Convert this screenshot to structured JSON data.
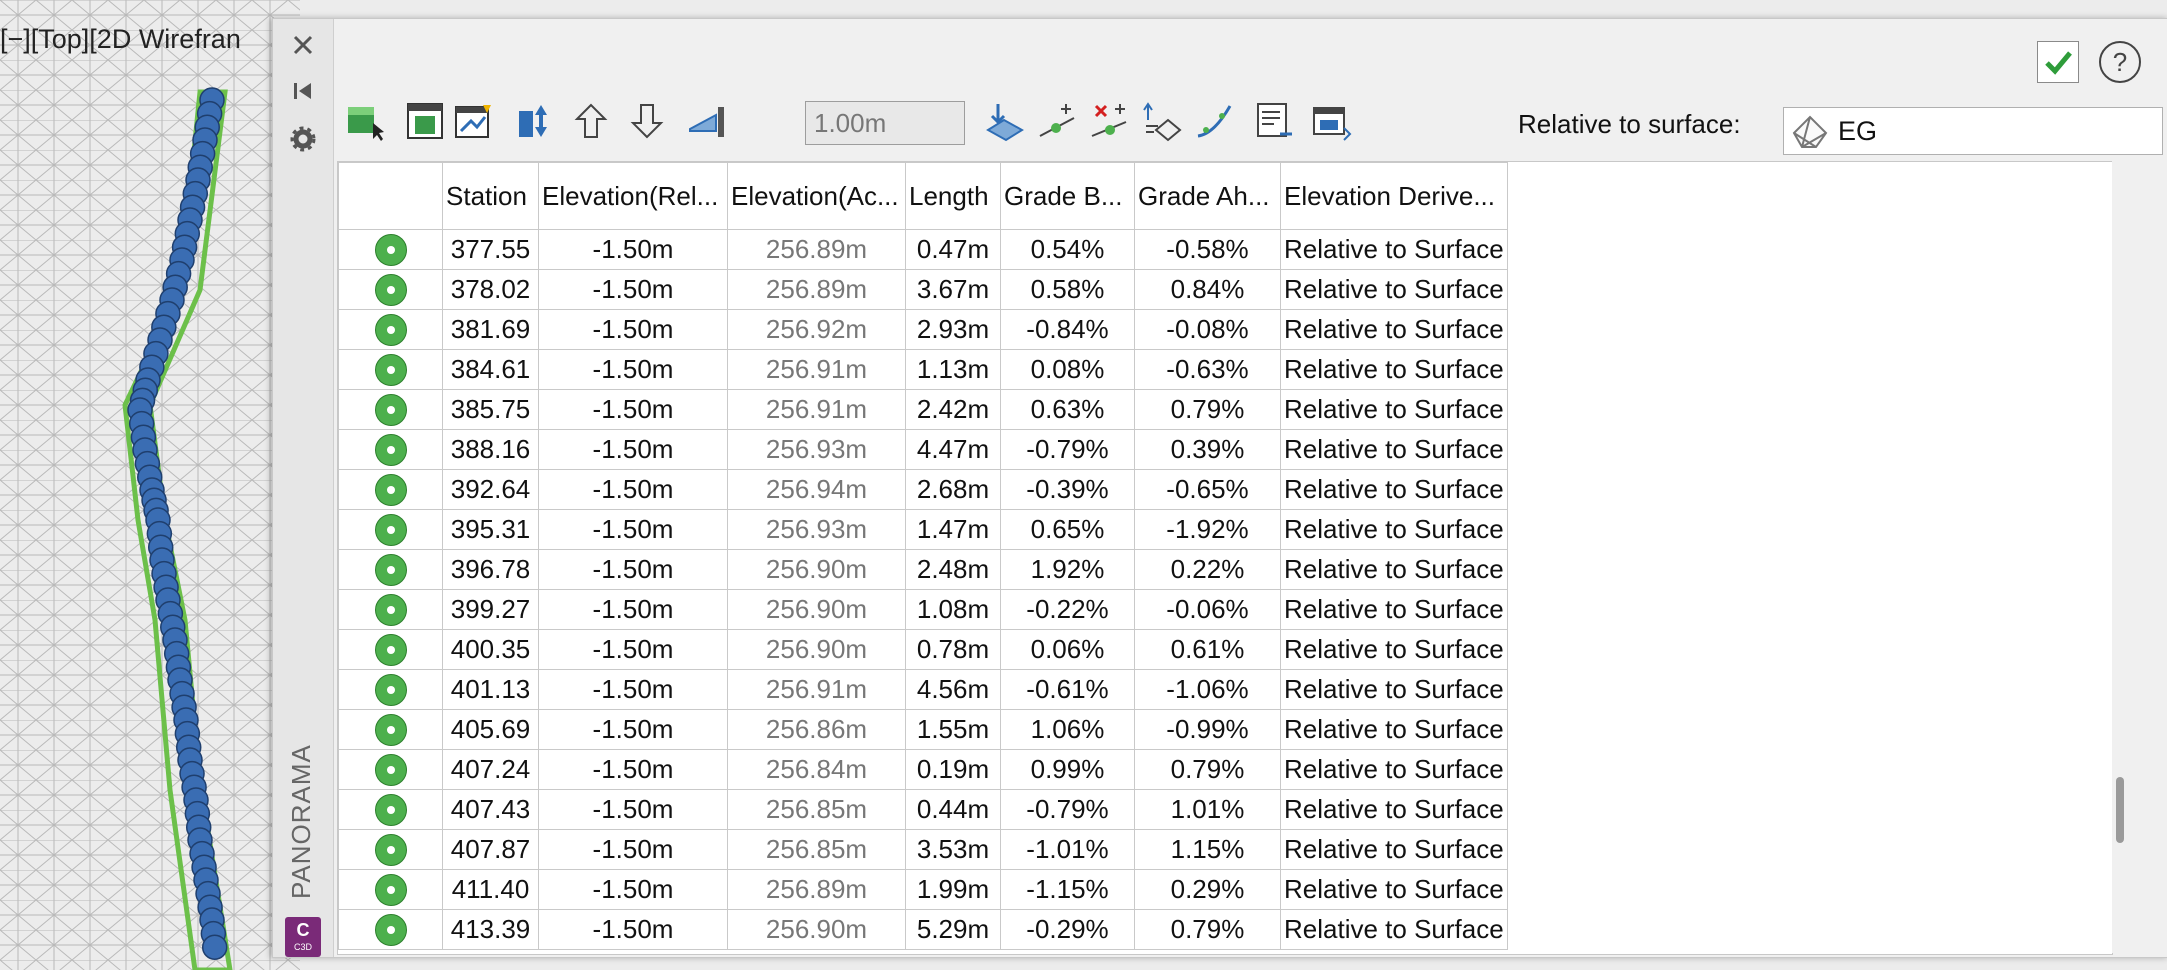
{
  "viewport": {
    "label": "[−][Top][2D Wirefran"
  },
  "palette": {
    "title": "PANORAMA",
    "badge": {
      "letter": "C",
      "sub": "C3D"
    },
    "close_icon": "close-icon",
    "help_label": "?"
  },
  "toolbar": {
    "distance_value": "1.00m",
    "relative_label": "Relative to surface:",
    "surface_value": "EG"
  },
  "grid": {
    "columns": [
      "",
      "Station",
      "Elevation(Rel...",
      "Elevation(Ac...",
      "Length",
      "Grade B...",
      "Grade Ah...",
      "Elevation Derive..."
    ],
    "rows": [
      {
        "station": "377.55",
        "elev_rel": "-1.50m",
        "elev_act": "256.89m",
        "length": "0.47m",
        "grade_b": "0.54%",
        "grade_a": "-0.58%",
        "derived": "Relative to Surface"
      },
      {
        "station": "378.02",
        "elev_rel": "-1.50m",
        "elev_act": "256.89m",
        "length": "3.67m",
        "grade_b": "0.58%",
        "grade_a": "0.84%",
        "derived": "Relative to Surface"
      },
      {
        "station": "381.69",
        "elev_rel": "-1.50m",
        "elev_act": "256.92m",
        "length": "2.93m",
        "grade_b": "-0.84%",
        "grade_a": "-0.08%",
        "derived": "Relative to Surface"
      },
      {
        "station": "384.61",
        "elev_rel": "-1.50m",
        "elev_act": "256.91m",
        "length": "1.13m",
        "grade_b": "0.08%",
        "grade_a": "-0.63%",
        "derived": "Relative to Surface"
      },
      {
        "station": "385.75",
        "elev_rel": "-1.50m",
        "elev_act": "256.91m",
        "length": "2.42m",
        "grade_b": "0.63%",
        "grade_a": "0.79%",
        "derived": "Relative to Surface"
      },
      {
        "station": "388.16",
        "elev_rel": "-1.50m",
        "elev_act": "256.93m",
        "length": "4.47m",
        "grade_b": "-0.79%",
        "grade_a": "0.39%",
        "derived": "Relative to Surface"
      },
      {
        "station": "392.64",
        "elev_rel": "-1.50m",
        "elev_act": "256.94m",
        "length": "2.68m",
        "grade_b": "-0.39%",
        "grade_a": "-0.65%",
        "derived": "Relative to Surface"
      },
      {
        "station": "395.31",
        "elev_rel": "-1.50m",
        "elev_act": "256.93m",
        "length": "1.47m",
        "grade_b": "0.65%",
        "grade_a": "-1.92%",
        "derived": "Relative to Surface"
      },
      {
        "station": "396.78",
        "elev_rel": "-1.50m",
        "elev_act": "256.90m",
        "length": "2.48m",
        "grade_b": "1.92%",
        "grade_a": "0.22%",
        "derived": "Relative to Surface"
      },
      {
        "station": "399.27",
        "elev_rel": "-1.50m",
        "elev_act": "256.90m",
        "length": "1.08m",
        "grade_b": "-0.22%",
        "grade_a": "-0.06%",
        "derived": "Relative to Surface"
      },
      {
        "station": "400.35",
        "elev_rel": "-1.50m",
        "elev_act": "256.90m",
        "length": "0.78m",
        "grade_b": "0.06%",
        "grade_a": "0.61%",
        "derived": "Relative to Surface"
      },
      {
        "station": "401.13",
        "elev_rel": "-1.50m",
        "elev_act": "256.91m",
        "length": "4.56m",
        "grade_b": "-0.61%",
        "grade_a": "-1.06%",
        "derived": "Relative to Surface"
      },
      {
        "station": "405.69",
        "elev_rel": "-1.50m",
        "elev_act": "256.86m",
        "length": "1.55m",
        "grade_b": "1.06%",
        "grade_a": "-0.99%",
        "derived": "Relative to Surface"
      },
      {
        "station": "407.24",
        "elev_rel": "-1.50m",
        "elev_act": "256.84m",
        "length": "0.19m",
        "grade_b": "0.99%",
        "grade_a": "0.79%",
        "derived": "Relative to Surface"
      },
      {
        "station": "407.43",
        "elev_rel": "-1.50m",
        "elev_act": "256.85m",
        "length": "0.44m",
        "grade_b": "-0.79%",
        "grade_a": "1.01%",
        "derived": "Relative to Surface"
      },
      {
        "station": "407.87",
        "elev_rel": "-1.50m",
        "elev_act": "256.85m",
        "length": "3.53m",
        "grade_b": "-1.01%",
        "grade_a": "1.15%",
        "derived": "Relative to Surface"
      },
      {
        "station": "411.40",
        "elev_rel": "-1.50m",
        "elev_act": "256.89m",
        "length": "1.99m",
        "grade_b": "-1.15%",
        "grade_a": "0.29%",
        "derived": "Relative to Surface"
      },
      {
        "station": "413.39",
        "elev_rel": "-1.50m",
        "elev_act": "256.90m",
        "length": "5.29m",
        "grade_b": "-0.29%",
        "grade_a": "0.79%",
        "derived": "Relative to Surface"
      }
    ]
  },
  "colors": {
    "accent_green": "#4db04d",
    "badge_purple": "#7a2a78",
    "point_blue": "#3a6db3",
    "corridor_green": "#6cc04a"
  }
}
